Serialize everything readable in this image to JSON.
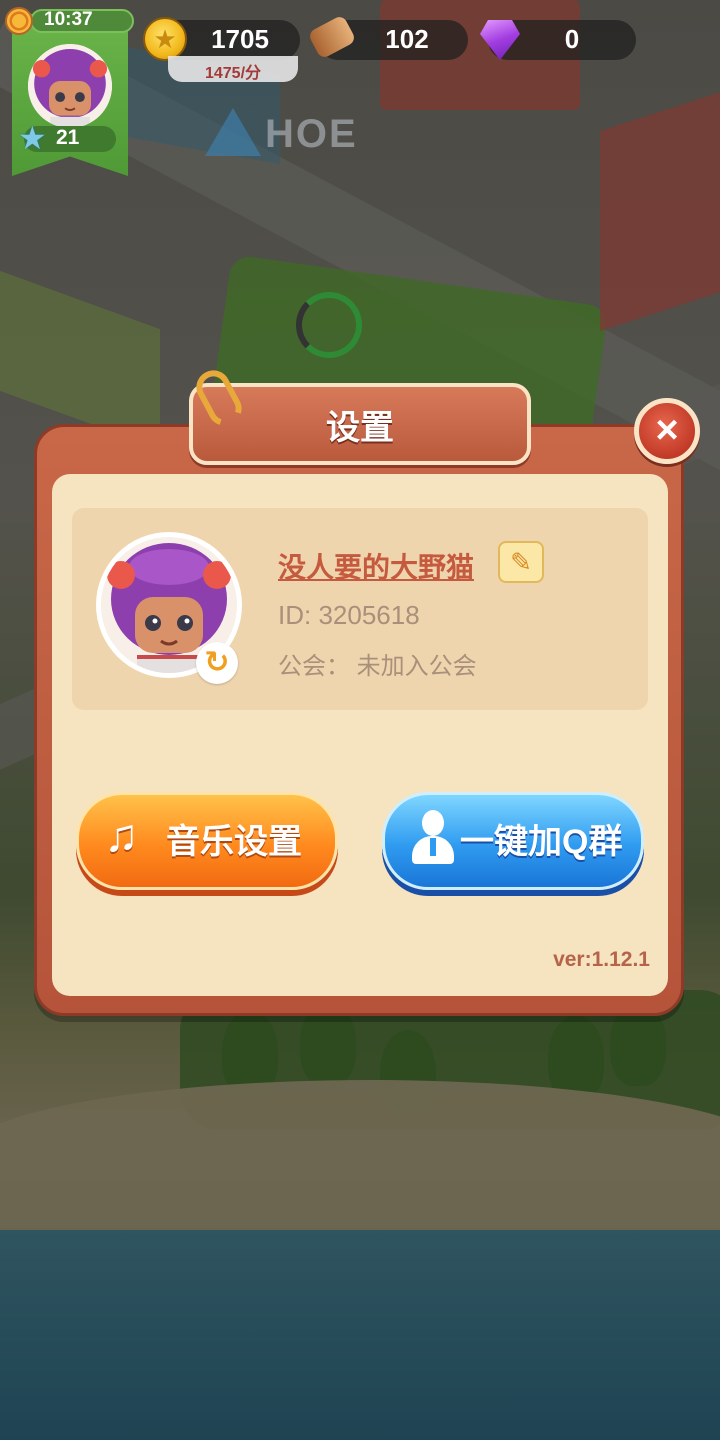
{
  "hud": {
    "time": "10:37",
    "level": "21",
    "gold": "1705",
    "gold_rate": "1475/分",
    "wood": "102",
    "gems": "0",
    "icons": {
      "sun": "sun-icon",
      "star": "star-icon",
      "coin": "coin-icon",
      "wood": "wood-log-icon",
      "gem": "purple-gem-icon"
    }
  },
  "background": {
    "sign_text": "HOE"
  },
  "dialog": {
    "title": "设置",
    "close_icon": "×",
    "profile": {
      "nickname": "没人要的大野猫",
      "id": "ID: 3205618",
      "guild": "公会：  未加入公会",
      "edit_icon": "✎",
      "refresh_icon": "↻"
    },
    "buttons": {
      "music": "音乐设置",
      "qq": "一键加Q群",
      "music_icon": "♫"
    },
    "version": "ver:1.12.1"
  },
  "colors": {
    "dialog_frame": "#b5543a",
    "dialog_panel": "#f6e3c0",
    "music_button": "#ff8a1e",
    "qq_button": "#2f9bf0",
    "nickname": "#c55a3e"
  }
}
